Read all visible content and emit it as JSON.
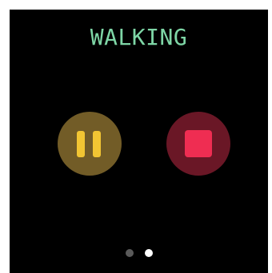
{
  "workout": {
    "activity_title": "WALKING"
  },
  "controls": {
    "pause_icon": "pause-icon",
    "stop_icon": "stop-icon"
  },
  "pager": {
    "page_count": 2,
    "current_page": 2
  },
  "colors": {
    "title": "#7ed6a6",
    "pause_accent": "#f2c533",
    "pause_background": "#725c27",
    "stop_accent": "#ef2d52",
    "stop_background": "#6a1726",
    "screen_background": "#000000"
  }
}
